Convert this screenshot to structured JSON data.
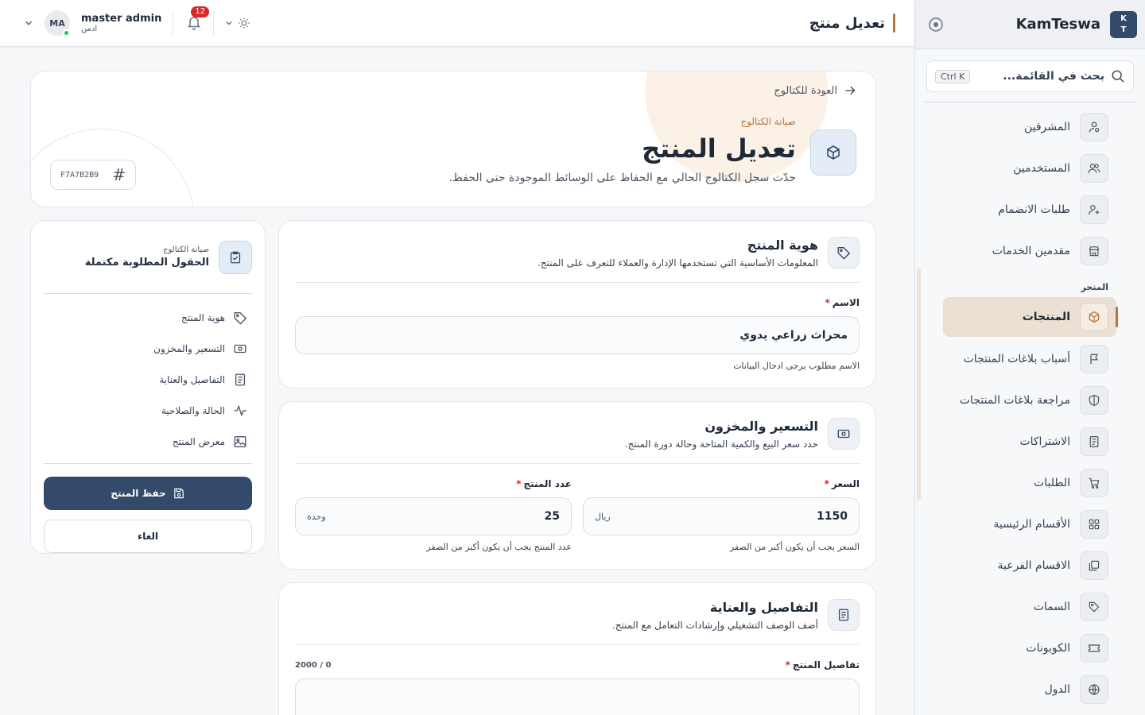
{
  "sidebar": {
    "logo_line1": "K",
    "logo_line2": "T",
    "brand": "KamTeswa",
    "search_placeholder": "بحث في القائمة...",
    "search_shortcut": "Ctrl K",
    "items_top": [
      {
        "label": "المشرفين",
        "icon": "admins-icon"
      },
      {
        "label": "المستخدمين",
        "icon": "users-icon"
      },
      {
        "label": "طلبات الانضمام",
        "icon": "join-requests-icon"
      },
      {
        "label": "مقدمين الخدمات",
        "icon": "store-icon"
      }
    ],
    "section_store": "المتجر",
    "items_store": [
      {
        "label": "المنتجات",
        "icon": "box-icon",
        "active": true
      },
      {
        "label": "أسباب بلاغات المنتجات",
        "icon": "flag-icon"
      },
      {
        "label": "مراجعة بلاغات المنتجات",
        "icon": "shield-icon"
      },
      {
        "label": "الاشتراكات",
        "icon": "receipt-icon"
      },
      {
        "label": "الطلبات",
        "icon": "cart-icon"
      },
      {
        "label": "الأقسام الرئيسية",
        "icon": "grid-icon"
      },
      {
        "label": "الاقسام الفرعية",
        "icon": "layers-icon"
      },
      {
        "label": "السمات",
        "icon": "tags-icon"
      },
      {
        "label": "الكوبونات",
        "icon": "ticket-icon"
      },
      {
        "label": "الدول",
        "icon": "globe-icon"
      }
    ]
  },
  "header": {
    "title": "تعديل منتج",
    "user_name": "master admin",
    "user_role": "ادمن",
    "avatar_initials": "MA",
    "notifications_count": "12"
  },
  "hero": {
    "back_label": "العودة للكتالوج",
    "eyebrow": "صيانة الكتالوج",
    "title": "تعديل المنتج",
    "subtitle": "حدّث سجل الكتالوج الحالي مع الحفاظ على الوسائط الموجودة حتى الحفظ.",
    "sku": "F7A7B2B9",
    "sku_hash": "#"
  },
  "identity": {
    "title": "هوية المنتج",
    "desc": "المعلومات الأساسية التي تستخدمها الإدارة والعملاء للتعرف على المنتج.",
    "name_label": "الاسم",
    "name_value": "محراث زراعي يدوي",
    "name_hint": "الاسم مطلوب يرجى ادخال البيانات",
    "required_mark": "*"
  },
  "pricing": {
    "title": "التسعير والمخزون",
    "desc": "حدد سعر البيع والكمية المتاحة وحالة دورة المنتج.",
    "price_label": "السعر",
    "price_value": "1150",
    "price_unit": "ريال",
    "price_hint": "السعر يجب أن يكون أكبر من الصفر",
    "qty_label": "عدد المنتج",
    "qty_value": "25",
    "qty_unit": "وحدة",
    "qty_hint": "عدد المنتج يجب أن يكون أكبر من الصفر"
  },
  "details": {
    "title": "التفاصيل والعناية",
    "desc": "أضف الوصف التشغيلي وإرشادات التعامل مع المنتج.",
    "field_label": "تفاصيل المنتج",
    "counter": "2000 / 0"
  },
  "panel": {
    "eyebrow": "صيانة الكتالوج",
    "title": "الحقول المطلوبة مكتملة",
    "toc": [
      {
        "label": "هوية المنتج",
        "icon": "tag-icon"
      },
      {
        "label": "التسعير والمخزون",
        "icon": "money-icon"
      },
      {
        "label": "التفاصيل والعناية",
        "icon": "document-icon"
      },
      {
        "label": "الحالة والصلاحية",
        "icon": "activity-icon"
      },
      {
        "label": "معرض المنتج",
        "icon": "image-icon"
      }
    ],
    "save_label": "حفظ المنتج",
    "cancel_label": "الغاء"
  },
  "colors": {
    "primary": "#334a6b",
    "accent": "#b7743b",
    "danger": "#dc2626",
    "online": "#22c55e"
  }
}
